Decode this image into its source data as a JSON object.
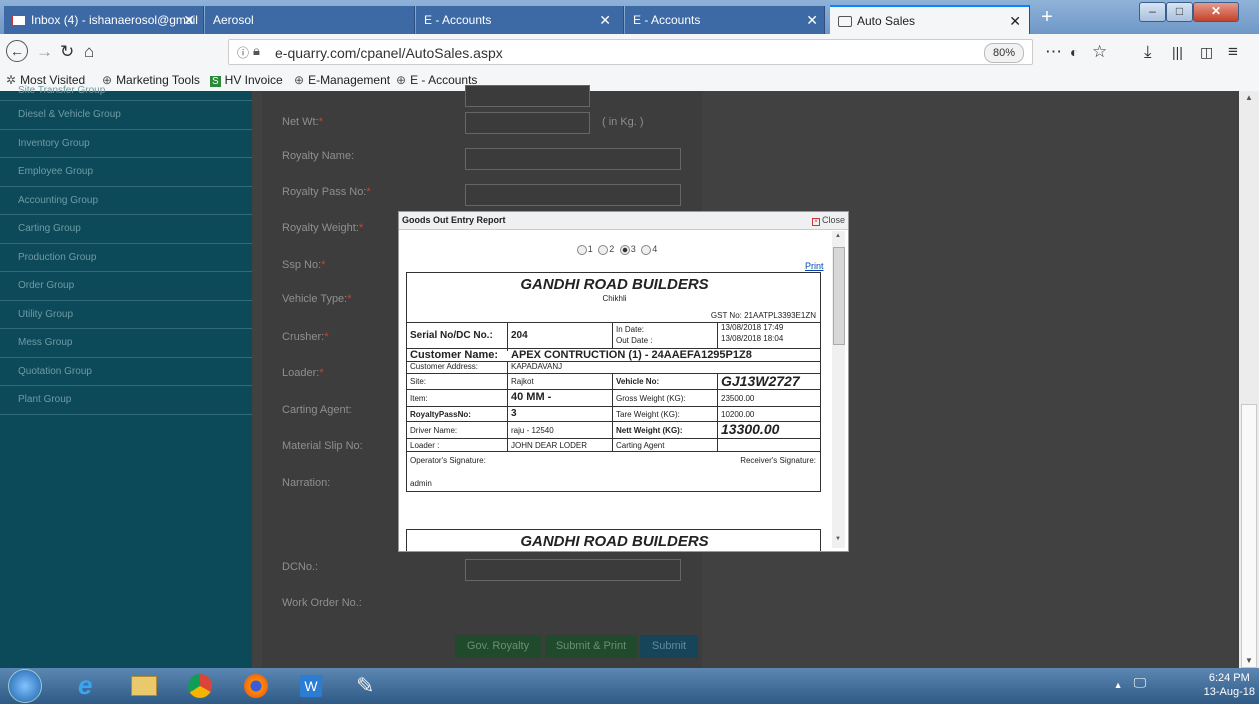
{
  "browser": {
    "tabs": [
      {
        "label": "Inbox (4) - ishanaerosol@gmail",
        "close": "✕"
      },
      {
        "label": "Aerosol",
        "close": ""
      },
      {
        "label": "E - Accounts",
        "close": "✕"
      },
      {
        "label": "E - Accounts",
        "close": "✕"
      },
      {
        "label": "Auto Sales",
        "close": "✕"
      }
    ],
    "new_tab": "+",
    "window_buttons": {
      "minimize": "–",
      "maximize": "□",
      "close": "✕"
    },
    "url": "e-quarry.com/cpanel/AutoSales.aspx",
    "zoom": "80%",
    "toolbar_icons": [
      "more-icon",
      "pocket-icon",
      "star-icon",
      "download-icon",
      "library-icon",
      "sidebar-icon",
      "menu-icon"
    ],
    "bookmarks": [
      "Most Visited",
      "Marketing Tools",
      "HV Invoice",
      "E-Management",
      "E - Accounts"
    ]
  },
  "sidebar": {
    "items": [
      "Site Transfer Group",
      "Diesel & Vehicle Group",
      "Inventory Group",
      "Employee Group",
      "Accounting Group",
      "Carting Group",
      "Production Group",
      "Order Group",
      "Utility Group",
      "Mess Group",
      "Quotation Group",
      "Plant Group"
    ]
  },
  "form": {
    "net_wt": "Net Wt:",
    "net_wt_unit": "( in Kg. )",
    "royalty_name": "Royalty Name:",
    "royalty_pass_no": "Royalty Pass No:",
    "royalty_weight": "Royalty Weight:",
    "ssp_no": "Ssp No:",
    "vehicle_type": "Vehicle Type:",
    "crusher": "Crusher:",
    "loader": "Loader:",
    "carting_agent": "Carting Agent:",
    "material_slip_no": "Material Slip No:",
    "narration": "Narration:",
    "dc_no": "DCNo.:",
    "work_order_no": "Work Order No.:",
    "required_mark": "*",
    "buttons": {
      "gov_royalty": "Gov. Royalty",
      "submit_print": "Submit & Print",
      "submit": "Submit"
    }
  },
  "modal": {
    "title": "Goods Out Entry Report",
    "close": "Close",
    "radio_options": [
      "1",
      "2",
      "3",
      "4"
    ],
    "selected_option": "3",
    "print": "Print",
    "report": {
      "company": "GANDHI ROAD BUILDERS",
      "location": "Chikhli",
      "gst": "GST No: 21AATPL3393E1ZN",
      "serial_label": "Serial No/DC No.:",
      "serial_value": "204",
      "in_date_label": "In Date:",
      "in_date_value": "13/08/2018 17:49",
      "out_date_label": "Out Date :",
      "out_date_value": "13/08/2018 18:04",
      "customer_label": "Customer Name:",
      "customer_value": "APEX CONTRUCTION (1) - 24AAEFA1295P1Z8",
      "address_label": "Customer Address:",
      "address_value": "KAPADAVANJ",
      "site_label": "Site:",
      "site_value": "Rajkot",
      "vehicle_label": "Vehicle No:",
      "vehicle_value": "GJ13W2727",
      "item_label": "Item:",
      "item_value": "40 MM -",
      "gross_label": "Gross Weight (KG):",
      "gross_value": "23500.00",
      "royalty_label": "RoyaltyPassNo:",
      "royalty_value": "3",
      "tare_label": "Tare Weight (KG):",
      "tare_value": "10200.00",
      "driver_label": "Driver Name:",
      "driver_value": "raju - 12540",
      "nett_label": "Nett Weight (KG):",
      "nett_value": "13300.00",
      "loader_label": "Loader :",
      "loader_value": "JOHN DEAR LODER",
      "carting_label": "Carting Agent",
      "operator_sig": "Operator's Signature:",
      "receiver_sig": "Receiver's Signature:",
      "operator_name": "admin"
    },
    "second_copy_company": "GANDHI ROAD BUILDERS"
  },
  "taskbar": {
    "time": "6:24 PM",
    "date": "13-Aug-18",
    "apps": [
      "start-icon",
      "ie-icon",
      "explorer-icon",
      "chrome-icon",
      "firefox-icon",
      "word-icon",
      "paint-icon"
    ]
  }
}
